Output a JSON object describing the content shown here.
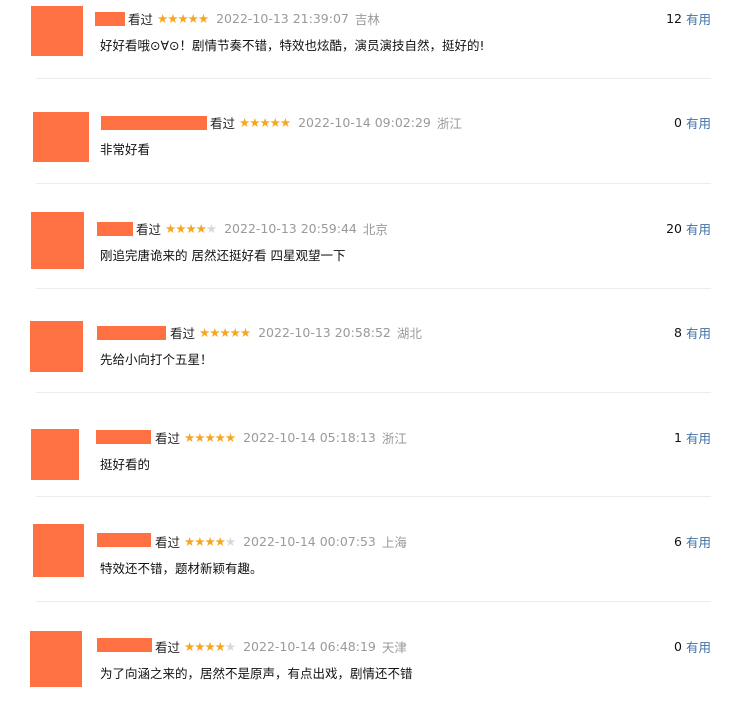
{
  "comments": [
    {
      "watched": "看过",
      "rating": 5,
      "time": "2022-10-13 21:39:07",
      "location": "吉林",
      "votes": "12",
      "useful_label": "有用",
      "text": "好好看哦⊙∀⊙！剧情节奏不错，特效也炫酷，演员演技自然，挺好的!"
    },
    {
      "watched": "看过",
      "rating": 5,
      "time": "2022-10-14 09:02:29",
      "location": "浙江",
      "votes": "0",
      "useful_label": "有用",
      "text": "非常好看"
    },
    {
      "watched": "看过",
      "rating": 4,
      "time": "2022-10-13 20:59:44",
      "location": "北京",
      "votes": "20",
      "useful_label": "有用",
      "text": "刚追完唐诡来的 居然还挺好看 四星观望一下"
    },
    {
      "watched": "看过",
      "rating": 5,
      "time": "2022-10-13 20:58:52",
      "location": "湖北",
      "votes": "8",
      "useful_label": "有用",
      "text": "先给小向打个五星！"
    },
    {
      "watched": "看过",
      "rating": 5,
      "time": "2022-10-14 05:18:13",
      "location": "浙江",
      "votes": "1",
      "useful_label": "有用",
      "text": "挺好看的"
    },
    {
      "watched": "看过",
      "rating": 4,
      "time": "2022-10-14 00:07:53",
      "location": "上海",
      "votes": "6",
      "useful_label": "有用",
      "text": "特效还不错，题材新颖有趣。"
    },
    {
      "watched": "看过",
      "rating": 4,
      "time": "2022-10-14 06:48:19",
      "location": "天津",
      "votes": "0",
      "useful_label": "有用",
      "text": "为了向涵之来的，居然不是原声，有点出戏，剧情还不错"
    }
  ],
  "colors": {
    "redaction": "#ff7043",
    "star_on": "#f5a623",
    "star_off": "#d8d8d8",
    "link": "#3f72a7",
    "muted": "#9a9a9a"
  },
  "icons": {
    "star_on": "filled-star-icon",
    "star_off": "empty-star-icon"
  }
}
